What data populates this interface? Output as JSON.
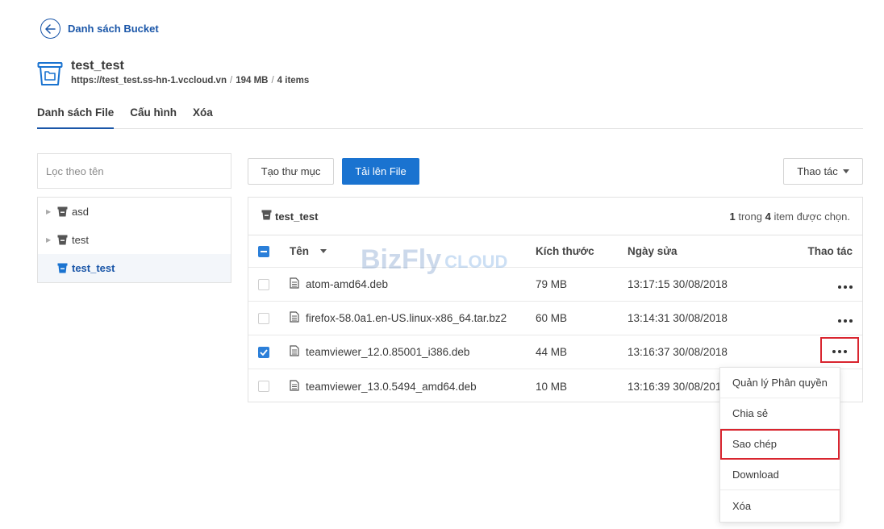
{
  "header": {
    "back_label": "Danh sách Bucket",
    "bucket_name": "test_test",
    "bucket_url": "https://test_test.ss-hn-1.vccloud.vn",
    "bucket_size": "194 MB",
    "bucket_items": "4 items",
    "separator": "/"
  },
  "tabs": [
    {
      "label": "Danh sách File",
      "active": true
    },
    {
      "label": "Cấu hình",
      "active": false
    },
    {
      "label": "Xóa",
      "active": false
    }
  ],
  "sidebar": {
    "filter_placeholder": "Lọc theo tên",
    "tree": [
      {
        "label": "asd",
        "icon": "bucket-icon",
        "expandable": true,
        "active": false
      },
      {
        "label": "test",
        "icon": "bucket-icon",
        "expandable": true,
        "active": false
      },
      {
        "label": "test_test",
        "icon": "bucket-icon",
        "expandable": false,
        "active": true
      }
    ]
  },
  "toolbar": {
    "new_folder_label": "Tạo thư mục",
    "upload_label": "Tải lên File",
    "actions_label": "Thao tác"
  },
  "panel": {
    "title": "test_test",
    "selected_count": "1",
    "count_mid": "trong",
    "total_count": "4",
    "count_suffix": "item được chọn."
  },
  "table": {
    "columns": {
      "name": "Tên",
      "size": "Kích thước",
      "date": "Ngày sửa",
      "actions": "Thao tác"
    },
    "rows": [
      {
        "name": "atom-amd64.deb",
        "size": "79 MB",
        "date": "13:17:15 30/08/2018",
        "checked": false
      },
      {
        "name": "firefox-58.0a1.en-US.linux-x86_64.tar.bz2",
        "size": "60 MB",
        "date": "13:14:31 30/08/2018",
        "checked": false
      },
      {
        "name": "teamviewer_12.0.85001_i386.deb",
        "size": "44 MB",
        "date": "13:16:37 30/08/2018",
        "checked": true
      },
      {
        "name": "teamviewer_13.0.5494_amd64.deb",
        "size": "10 MB",
        "date": "13:16:39 30/08/2018",
        "checked": false
      }
    ]
  },
  "watermark": {
    "brand": "BizFly",
    "suffix": "CLOUD"
  },
  "context_menu": {
    "items": [
      {
        "label": "Quản lý Phân quyền",
        "highlighted": false
      },
      {
        "label": "Chia sẻ",
        "highlighted": false
      },
      {
        "label": "Sao chép",
        "highlighted": true
      },
      {
        "label": "Download",
        "highlighted": false
      },
      {
        "label": "Xóa",
        "highlighted": false
      }
    ]
  },
  "colors": {
    "accent": "#1a56a8",
    "primary_button": "#1a73d0",
    "highlight": "#d9252f",
    "checkbox": "#2b7fd9"
  }
}
